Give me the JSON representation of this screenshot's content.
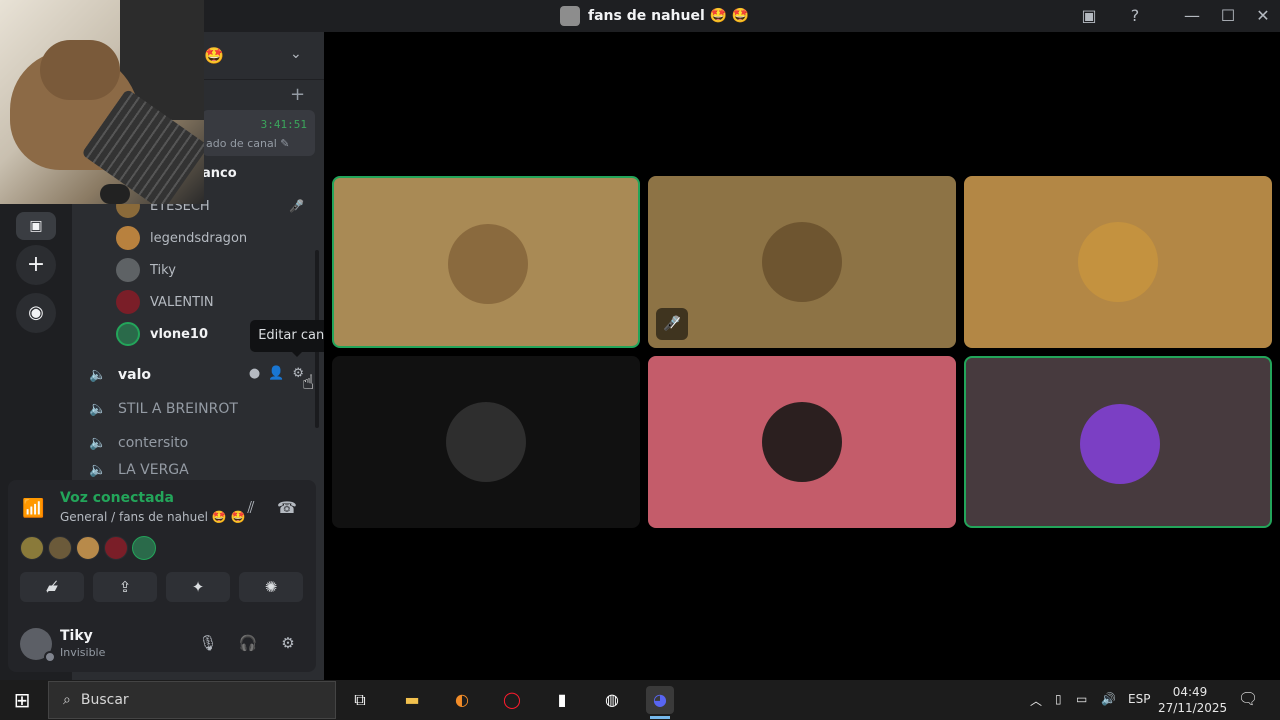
{
  "window": {
    "title": "fans de nahuel 🤩 🤩",
    "minimize_icon": "—",
    "maximize_icon": "☐",
    "close_icon": "✕"
  },
  "server": {
    "name_emoji": "🤩",
    "chevron": "⌄",
    "add_icon": "+"
  },
  "stage_card": {
    "time": "3:41:51",
    "subtitle": "ado de canal ✎"
  },
  "section_header": "anco",
  "members": [
    {
      "name": "ETESECH",
      "color": "#8a6a3a",
      "muted": true
    },
    {
      "name": "legendsdragon",
      "color": "#b8813e",
      "muted": false
    },
    {
      "name": "Tiky",
      "color": "#5e6265",
      "muted": false
    },
    {
      "name": "VALENTIN",
      "color": "#7a1e28",
      "muted": false
    },
    {
      "name": "vlone10",
      "color": "#2a6a4a",
      "muted": false,
      "me": true
    }
  ],
  "channels": [
    {
      "name": "valo",
      "selected": true
    },
    {
      "name": "STIL A BREINROT",
      "selected": false
    },
    {
      "name": "contersito",
      "selected": false
    },
    {
      "name": "LA VERGA",
      "selected": false
    }
  ],
  "tooltip": "Editar canal",
  "voice": {
    "title": "Voz conectada",
    "subtitle": "General / fans de nahuel 🤩 🤩",
    "avatars": [
      "#8a7a3a",
      "#6b5a3a",
      "#b88a4a",
      "#7a1e28",
      "#2a6a4a"
    ]
  },
  "user": {
    "name": "Tiky",
    "status": "Invisible"
  },
  "tiles": [
    {
      "bg": "#a98a55",
      "avatar": "#8a6a3e",
      "speaking": true,
      "muted": false
    },
    {
      "bg": "#8d7345",
      "avatar": "#6e5530",
      "speaking": false,
      "muted": true
    },
    {
      "bg": "#b38745",
      "avatar": "#c4923f",
      "speaking": false,
      "muted": false
    },
    {
      "bg": "#111111",
      "avatar": "#2e2e2e",
      "speaking": false,
      "muted": false
    },
    {
      "bg": "#c45c6a",
      "avatar": "#2b1f1f",
      "speaking": false,
      "muted": false
    },
    {
      "bg": "#473a3e",
      "avatar": "#7b3fc4",
      "speaking": true,
      "muted": false
    }
  ],
  "taskbar": {
    "search_placeholder": "Buscar",
    "lang": "ESP",
    "time": "04:49",
    "date": "27/11/2025"
  },
  "colors": {
    "accent_green": "#23a55a",
    "discord_blurple": "#5865f2"
  }
}
